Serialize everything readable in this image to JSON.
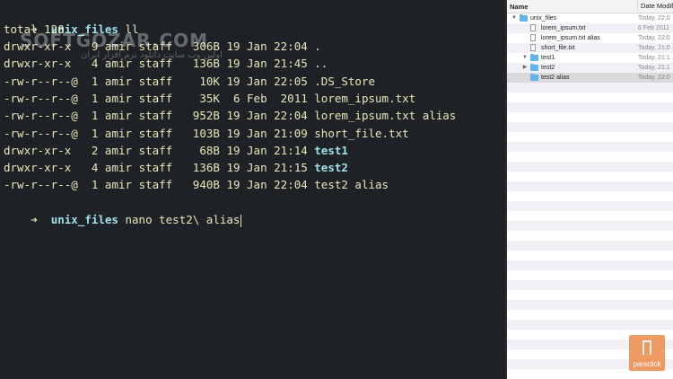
{
  "terminal": {
    "prompt_arrow": "➜",
    "prompt_dir": "unix_files",
    "command1": "ll",
    "total": "total 120",
    "listing": [
      {
        "perms": "drwxr-xr-x ",
        "links": " 9",
        "owner": "amir",
        "group": "staff",
        "size": " 306B",
        "date": "19 Jan 22:04",
        "name": ".",
        "is_dir_bold": false
      },
      {
        "perms": "drwxr-xr-x ",
        "links": " 4",
        "owner": "amir",
        "group": "staff",
        "size": " 136B",
        "date": "19 Jan 21:45",
        "name": "..",
        "is_dir_bold": false
      },
      {
        "perms": "-rw-r--r--@",
        "links": " 1",
        "owner": "amir",
        "group": "staff",
        "size": "  10K",
        "date": "19 Jan 22:05",
        "name": ".DS_Store",
        "is_dir_bold": false
      },
      {
        "perms": "-rw-r--r--@",
        "links": " 1",
        "owner": "amir",
        "group": "staff",
        "size": "  35K",
        "date": " 6 Feb  2011",
        "name": "lorem_ipsum.txt",
        "is_dir_bold": false
      },
      {
        "perms": "-rw-r--r--@",
        "links": " 1",
        "owner": "amir",
        "group": "staff",
        "size": " 952B",
        "date": "19 Jan 22:04",
        "name": "lorem_ipsum.txt alias",
        "is_dir_bold": false
      },
      {
        "perms": "-rw-r--r--@",
        "links": " 1",
        "owner": "amir",
        "group": "staff",
        "size": " 103B",
        "date": "19 Jan 21:09",
        "name": "short_file.txt",
        "is_dir_bold": false
      },
      {
        "perms": "drwxr-xr-x ",
        "links": " 2",
        "owner": "amir",
        "group": "staff",
        "size": "  68B",
        "date": "19 Jan 21:14",
        "name": "test1",
        "is_dir_bold": true
      },
      {
        "perms": "drwxr-xr-x ",
        "links": " 4",
        "owner": "amir",
        "group": "staff",
        "size": " 136B",
        "date": "19 Jan 21:15",
        "name": "test2",
        "is_dir_bold": true
      },
      {
        "perms": "-rw-r--r--@",
        "links": " 1",
        "owner": "amir",
        "group": "staff",
        "size": " 940B",
        "date": "19 Jan 22:04",
        "name": "test2 alias",
        "is_dir_bold": false
      }
    ],
    "command2": "nano test2\\ alias",
    "watermark": "SOFTGOZAR.COM",
    "watermark_sub": "اولین وب سایت دانلود نرم افزار ایران"
  },
  "finder": {
    "header_name": "Name",
    "header_date": "Date Modifie",
    "rows": [
      {
        "indent": 0,
        "arrow": "▼",
        "icon": "folder-icon",
        "name": "unix_files",
        "date": "Today, 22:0",
        "selected": false
      },
      {
        "indent": 1,
        "arrow": "",
        "icon": "file-icon",
        "name": "lorem_ipsum.txt",
        "date": "6 Feb 2011",
        "selected": false
      },
      {
        "indent": 1,
        "arrow": "",
        "icon": "file-icon",
        "name": "lorem_ipsum.txt alias",
        "date": "Today, 22:0",
        "selected": false
      },
      {
        "indent": 1,
        "arrow": "",
        "icon": "file-icon",
        "name": "short_file.txt",
        "date": "Today, 21:0",
        "selected": false
      },
      {
        "indent": 1,
        "arrow": "▼",
        "icon": "folder-icon",
        "name": "test1",
        "date": "Today, 21:1",
        "selected": false
      },
      {
        "indent": 1,
        "arrow": "▶",
        "icon": "folder-icon",
        "name": "test2",
        "date": "Today, 21:1",
        "selected": false
      },
      {
        "indent": 1,
        "arrow": "",
        "icon": "folder-icon",
        "name": "test2 alias",
        "date": "Today, 22:0",
        "selected": true
      }
    ],
    "empty_rows": 30
  },
  "badge": {
    "text": "parsclick"
  },
  "colors": {
    "terminal_bg": "#1e2227",
    "terminal_text": "#e8e6b8",
    "dir_highlight": "#9fe0e8",
    "finder_stripe": "#f2f0f5",
    "selection": "#d9d9dc",
    "folder": "#62b5ea",
    "badge": "#ec8a4a"
  }
}
